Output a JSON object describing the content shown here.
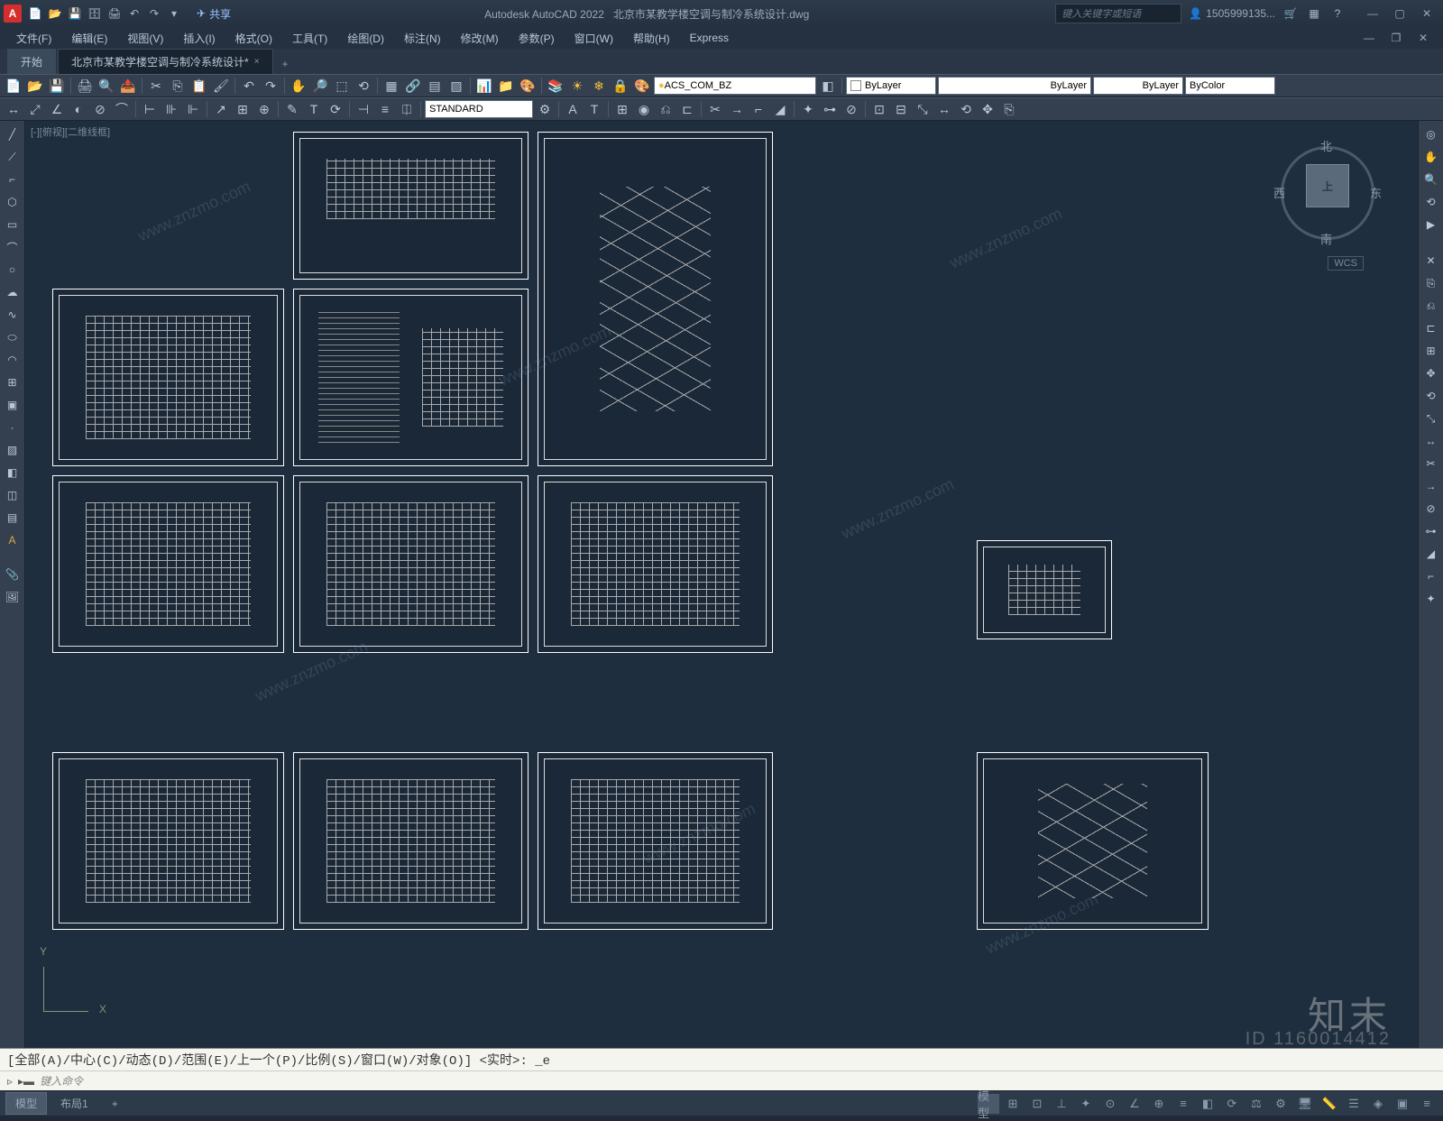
{
  "titlebar": {
    "app_letter": "A",
    "share_label": "共享",
    "app_title": "Autodesk AutoCAD 2022",
    "doc_title": "北京市某教学楼空调与制冷系统设计.dwg",
    "search_placeholder": "键入关键字或短语",
    "username": "1505999135..."
  },
  "menubar": [
    "文件(F)",
    "编辑(E)",
    "视图(V)",
    "插入(I)",
    "格式(O)",
    "工具(T)",
    "绘图(D)",
    "标注(N)",
    "修改(M)",
    "参数(P)",
    "窗口(W)",
    "帮助(H)",
    "Express"
  ],
  "tabs": {
    "start": "开始",
    "doc": "北京市某教学楼空调与制冷系统设计*",
    "close": "×",
    "add": "+"
  },
  "toolbars": {
    "layer_dropdown": "ACS_COM_BZ",
    "bylayer1": "ByLayer",
    "bylayer2": "ByLayer",
    "bylayer3": "ByLayer",
    "bycolor": "ByColor",
    "style_dropdown": "STANDARD"
  },
  "viewport": {
    "label": "[-][俯视][二维线框]",
    "wcs": "WCS",
    "ucs_x": "X",
    "ucs_y": "Y"
  },
  "viewcube": {
    "top": "上",
    "north": "北",
    "south": "南",
    "east": "东",
    "west": "西"
  },
  "command": {
    "history": "[全部(A)/中心(C)/动态(D)/范围(E)/上一个(P)/比例(S)/窗口(W)/对象(O)] <实时>: _e",
    "prompt_icon": "▹",
    "dash": "▸▬",
    "placeholder": "键入命令"
  },
  "statusbar": {
    "model": "模型",
    "layout1": "布局1",
    "add": "+",
    "right_label": "模型"
  },
  "watermark": {
    "brand": "知末",
    "id": "ID 1160014412",
    "url": "www.znzmo.com"
  }
}
